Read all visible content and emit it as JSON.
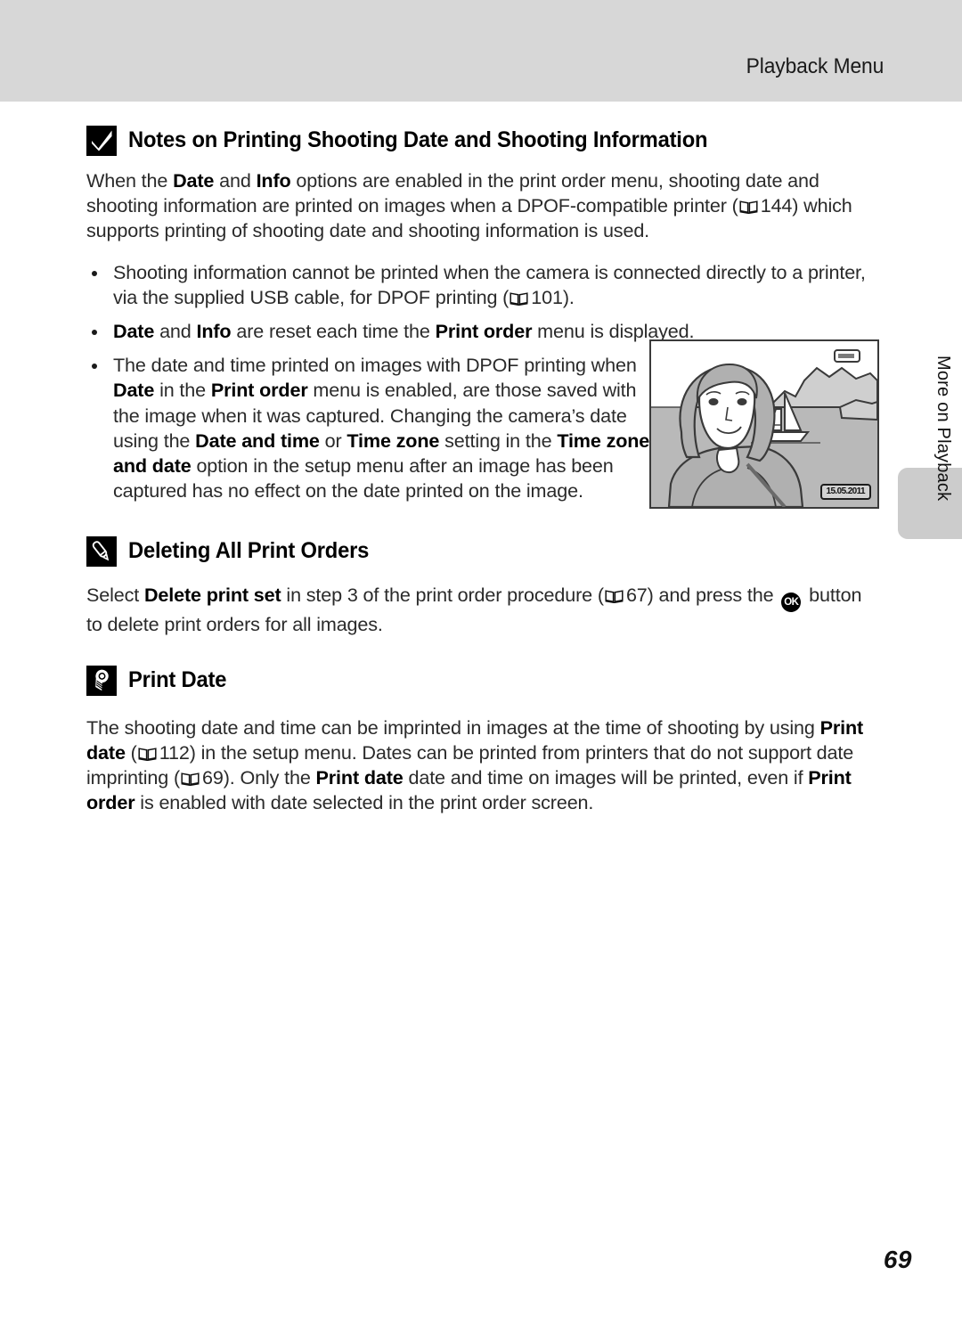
{
  "header": {
    "title": "Playback Menu"
  },
  "side_tab": {
    "label": "More on Playback"
  },
  "page": {
    "number": "69"
  },
  "sections": [
    {
      "id": "notes-printing",
      "icon": "checkmark-box-icon",
      "title": "Notes on Printing Shooting Date and Shooting Information",
      "intro": {
        "p1_a": "When the ",
        "p1_b1": "Date",
        "p1_c": " and ",
        "p1_b2": "Info",
        "p1_d": " options are enabled in the print order menu, shooting date and shooting information are printed on images when a DPOF-compatible printer (",
        "p1_ref": "144",
        "p1_e": ") which supports printing of shooting date and shooting information is used."
      },
      "bullets": [
        {
          "a": "Shooting information cannot be printed when the camera is connected directly to a printer, via the supplied USB cable, for DPOF printing (",
          "ref": "101",
          "b": ")."
        },
        {
          "b1": "Date",
          "a": " and ",
          "b2": "Info",
          "c": " are reset each time the ",
          "b3": "Print order",
          "d": " menu is displayed."
        },
        {
          "a": "The date and time printed on images with DPOF printing when ",
          "b1": "Date",
          "b": " in the ",
          "b2": "Print order",
          "c": " menu is enabled, are those saved with the image when it was captured. Changing the camera’s date using the ",
          "b3": "Date and time",
          "d": " or ",
          "b4": "Time zone",
          "e": " setting in the ",
          "b5": "Time zone and date",
          "f": " option in the setup menu after an image has been captured has no effect on the date printed on the image."
        }
      ]
    },
    {
      "id": "deleting-all-print-orders",
      "icon": "pencil-box-icon",
      "title": "Deleting All Print Orders",
      "body": {
        "a": "Select ",
        "b1": "Delete print set",
        "b": " in step 3 of the print order procedure (",
        "ref": "67",
        "c": ") and press the ",
        "ok": "OK",
        "d": " button to delete print orders for all images."
      }
    },
    {
      "id": "print-date",
      "icon": "lightbulb-box-icon",
      "title": "Print Date",
      "body": {
        "a": "The shooting date and time can be imprinted in images at the time of shooting by using ",
        "b1": "Print date",
        "b": " (",
        "ref1": "112",
        "c": ") in the setup menu. Dates can be printed from printers that do not support date imprinting (",
        "ref2": "69",
        "d": "). Only the ",
        "b2": "Print date",
        "e": " date and time on images will be printed, even if ",
        "b3": "Print order",
        "f": " is enabled with date selected in the print order screen."
      }
    }
  ],
  "illustration": {
    "name": "camera-playback-screen",
    "date_stamp": "15.05.2011",
    "battery_indicator": "battery-icon",
    "scene": "woman-with-sailboat-and-mountains"
  },
  "colors": {
    "header_band": "#d7d7d7",
    "side_tab": "#cccccc",
    "text": "#2a2a2a",
    "heading": "#000000",
    "page_bg": "#ffffff"
  }
}
